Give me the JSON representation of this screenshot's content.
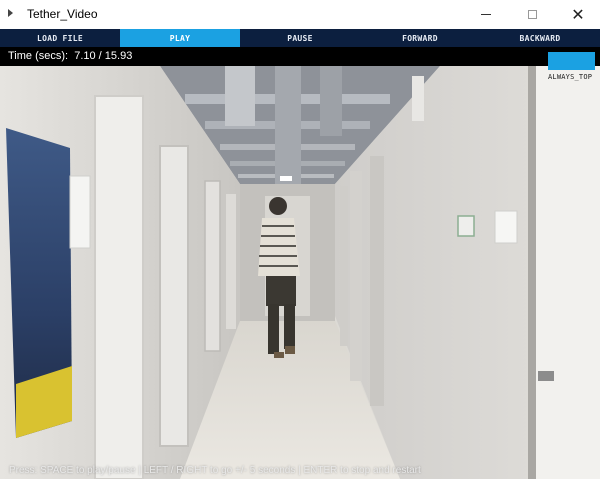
{
  "window": {
    "title": "Tether_Video"
  },
  "toolbar": {
    "buttons": [
      {
        "label": "LOAD FILE",
        "active": false
      },
      {
        "label": "PLAY",
        "active": true
      },
      {
        "label": "PAUSE",
        "active": false
      },
      {
        "label": "FORWARD",
        "active": false
      },
      {
        "label": "BACKWARD",
        "active": false
      }
    ]
  },
  "time": {
    "label": "Time (secs):",
    "current": "7.10",
    "total": "15.93",
    "display": "Time (secs):  7.10 / 15.93"
  },
  "always_top": {
    "label": "ALWAYS_TOP"
  },
  "status": {
    "text": "Press: SPACE to play/pause | LEFT / RIGHT to go +/- 5 seconds | ENTER to stop and restart"
  },
  "colors": {
    "toolbar_bg": "#0c1f3f",
    "accent": "#1ba1e2",
    "timebar_bg": "#000000"
  }
}
